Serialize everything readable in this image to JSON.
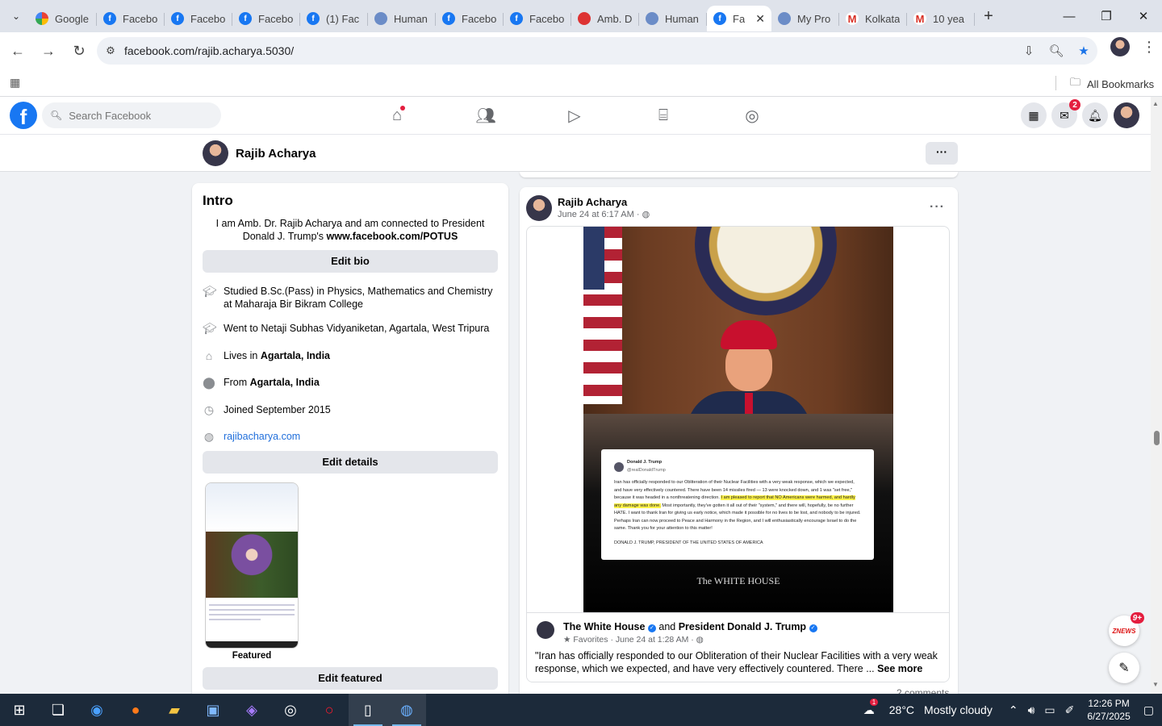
{
  "browser": {
    "tabs": [
      {
        "label": "Google",
        "icon": "google"
      },
      {
        "label": "Facebo",
        "icon": "facebook"
      },
      {
        "label": "Facebo",
        "icon": "facebook"
      },
      {
        "label": "Facebo",
        "icon": "facebook"
      },
      {
        "label": "(1) Fac",
        "icon": "facebook"
      },
      {
        "label": "Human",
        "icon": "globe"
      },
      {
        "label": "Facebo",
        "icon": "facebook"
      },
      {
        "label": "Facebo",
        "icon": "facebook"
      },
      {
        "label": "Amb. D",
        "icon": "red-badge"
      },
      {
        "label": "Human",
        "icon": "globe"
      },
      {
        "label": "Fa",
        "icon": "facebook",
        "active": true
      },
      {
        "label": "My Pro",
        "icon": "globe"
      },
      {
        "label": "Kolkata",
        "icon": "gmail"
      },
      {
        "label": "10 yea",
        "icon": "gmail"
      }
    ],
    "url": "facebook.com/rajib.acharya.5030/",
    "bookmarks_label": "All Bookmarks"
  },
  "fb_header": {
    "search_placeholder": "Search Facebook",
    "messenger_badge": "2"
  },
  "profile_bar": {
    "name": "Rajib Acharya"
  },
  "intro": {
    "title": "Intro",
    "bio_text": "I am Amb. Dr. Rajib Acharya and am connected to President Donald J. Trump's ",
    "bio_link": "www.facebook.com/POTUS",
    "edit_bio": "Edit bio",
    "studied_prefix": "Studied B.Sc.(Pass) in Physics, Mathematics and Chemistry at Maharaja Bir Bikram College",
    "went_to": "Went to Netaji Subhas Vidyaniketan, Agartala, West Tripura",
    "lives_prefix": "Lives in ",
    "lives_place": "Agartala, India",
    "from_prefix": "From ",
    "from_place": "Agartala, India",
    "joined": "Joined September 2015",
    "website": "rajibacharya.com",
    "edit_details": "Edit details",
    "featured_label": "Featured",
    "edit_featured": "Edit featured"
  },
  "post": {
    "author": "Rajib Acharya",
    "date": "June 24 at 6:17 AM · ",
    "shared_page": "The White House",
    "and_text": " and ",
    "shared_with": "President Donald J. Trump",
    "shared_meta": "Favorites · June 24 at 1:28 AM · ",
    "shared_text": "\"Iran has officially responded to our Obliteration of their Nuclear Facilities with a very weak response, which we expected, and have very effectively countered. There ... ",
    "see_more": "See more",
    "comments_peek": "2 comments",
    "image": {
      "tweet_name": "Donald J. Trump",
      "tweet_handle": "@realDonaldTrump",
      "tweet_text_a": "Iran has officially responded to our Obliteration of their Nuclear Facilities with a very weak response, which we expected, and have very effectively countered. There have been 14 missiles fired — 13 were knocked down, and 1 was \"set free,\" because it was headed in a nonthreatening direction. ",
      "tweet_text_hl": "I am pleased to report that NO Americans were harmed, and hardly any damage was done.",
      "tweet_text_b": " Most importantly, they've gotten it all out of their \"system,\" and there will, hopefully, be no further HATE. I want to thank Iran for giving us early notice, which made it possible for no lives to be lost, and nobody to be injured. Perhaps Iran can now proceed to Peace and Harmony in the Region, and I will enthusiastically encourage Israel to do the same. Thank you for your attention to this matter!",
      "tweet_sign": "DONALD J. TRUMP, PRESIDENT OF THE UNITED STATES OF AMERICA",
      "wh_label": "The WHITE HOUSE"
    }
  },
  "floating": {
    "znews_label": "ZNEWS",
    "znews_badge": "9+"
  },
  "taskbar": {
    "weather_temp": "28°C",
    "weather_text": "Mostly cloudy",
    "weather_badge": "1",
    "time": "12:26 PM",
    "date": "6/27/2025"
  }
}
